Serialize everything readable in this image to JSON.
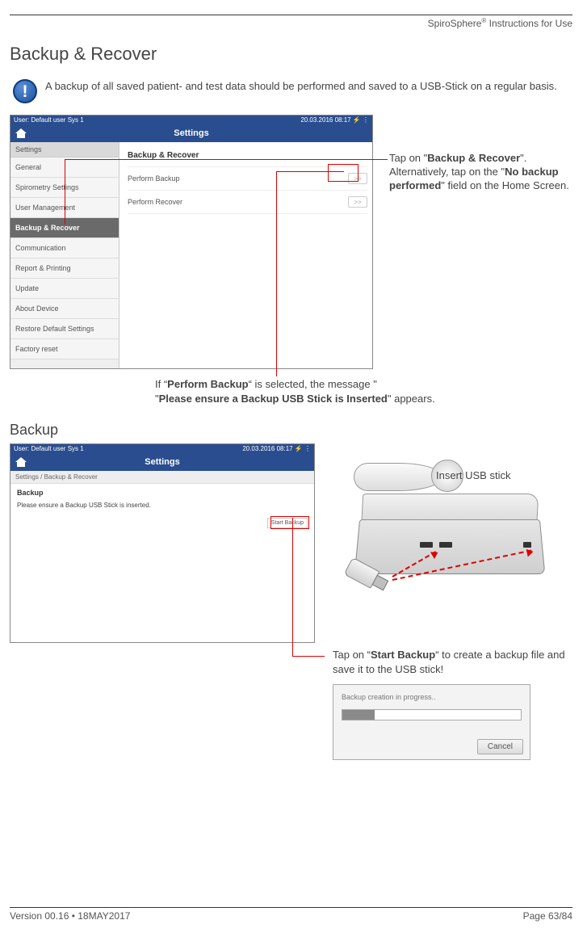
{
  "header": {
    "doc_title_pre": "SpiroSphere",
    "doc_title_sup": "®",
    "doc_title_post": " Instructions for Use"
  },
  "section_title": "Backup & Recover",
  "info_text": "A backup of all saved patient- and test data should be performed and saved to a USB-Stick on a regular basis.",
  "screenshot1": {
    "status_left": "User: Default user Sys 1",
    "status_right": "20.03.2016 08:17  ⚡  ⋮",
    "title": "Settings",
    "sidebar_head": "Settings",
    "sidebar": [
      "General",
      "Spirometry Settings",
      "User Management",
      "Backup & Recover",
      "Communication",
      "Report & Printing",
      "Update",
      "About Device",
      "Restore Default Settings",
      "Factory reset"
    ],
    "active_index": 3,
    "main_head": "Backup & Recover",
    "rows": [
      "Perform Backup",
      "Perform Recover"
    ]
  },
  "callout1": {
    "t1": "Tap on \"",
    "b1": "Backup & Recover",
    "t2": "\". Alternatively, tap on the \"",
    "b2": "No backup performed",
    "t3": "\" field on the Home Screen."
  },
  "mid_callout": {
    "t1": "If “",
    "b1": "Perform Backup",
    "t2": "“ is selected, the message \"",
    "b2": "Please ensure a Backup USB Stick is Inserted",
    "t3": "\" appears."
  },
  "sub_heading": "Backup",
  "screenshot2": {
    "status_left": "User: Default user Sys 1",
    "status_right": "20.03.2016 08:17  ⚡  ⋮",
    "title": "Settings",
    "crumb": "Settings / Backup & Recover",
    "head": "Backup",
    "msg": "Please ensure a Backup USB Stick is inserted.",
    "button": "Start Backup"
  },
  "insert_label": "Insert USB stick",
  "callout3": {
    "t1": "Tap on “",
    "b1": "Start Backup",
    "t2": "“ to create a backup file and save it to the USB stick!"
  },
  "progress": {
    "msg": "Backup creation in progress..",
    "cancel": "Cancel"
  },
  "footer": {
    "left": "Version 00.16 • 18MAY2017",
    "right": "Page 63/84"
  }
}
